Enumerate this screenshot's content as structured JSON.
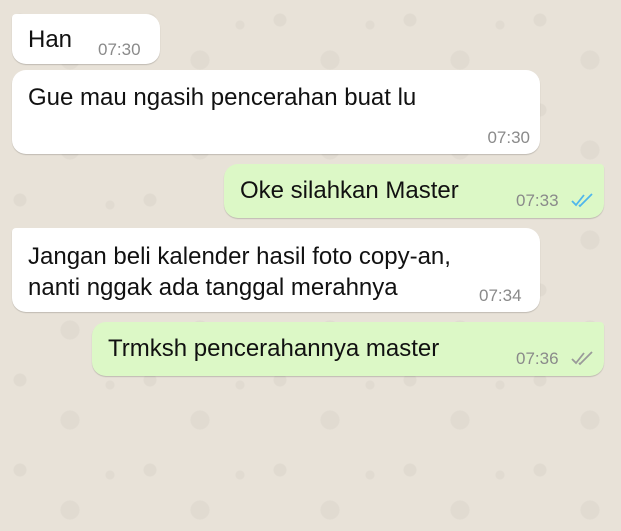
{
  "chat": {
    "messages": [
      {
        "direction": "incoming",
        "text": "Han",
        "time": "07:30"
      },
      {
        "direction": "incoming",
        "text": "Gue mau ngasih pencerahan buat lu",
        "time": "07:30"
      },
      {
        "direction": "outgoing",
        "text": "Oke silahkan Master",
        "time": "07:33",
        "ticks": "double-check-read-icon",
        "tick_color": "#4fb6ec"
      },
      {
        "direction": "incoming",
        "text_line1": "Jangan beli kalender hasil foto copy-an,",
        "text_line2": "nanti nggak ada tanggal merahnya",
        "time": "07:34"
      },
      {
        "direction": "outgoing",
        "text": "Trmksh pencerahannya master",
        "time": "07:36",
        "ticks": "double-check-delivered-icon",
        "tick_color": "#9a9a9a"
      }
    ]
  },
  "colors": {
    "incoming_bubble": "#ffffff",
    "outgoing_bubble": "#dcf8c6",
    "wallpaper": "#e8e2d8"
  }
}
